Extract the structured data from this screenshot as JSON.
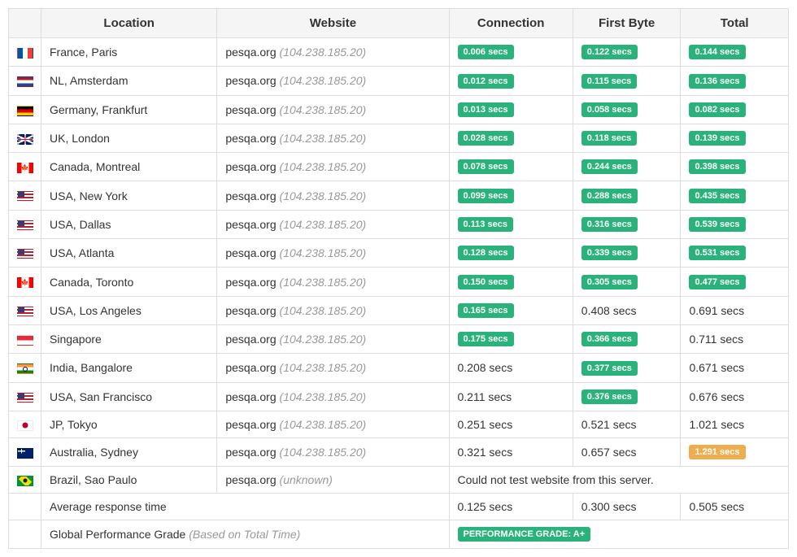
{
  "headers": {
    "location": "Location",
    "website": "Website",
    "connection": "Connection",
    "first_byte": "First Byte",
    "total": "Total"
  },
  "rows": [
    {
      "flag": "fr",
      "flag_name": "France",
      "location": "France, Paris",
      "site": "pesqa.org",
      "ip": "(104.238.185.20)",
      "conn": "0.006 secs",
      "conn_b": "green",
      "fb": "0.122 secs",
      "fb_b": "green",
      "tot": "0.144 secs",
      "tot_b": "green"
    },
    {
      "flag": "nl",
      "flag_name": "Netherlands",
      "location": "NL, Amsterdam",
      "site": "pesqa.org",
      "ip": "(104.238.185.20)",
      "conn": "0.012 secs",
      "conn_b": "green",
      "fb": "0.115 secs",
      "fb_b": "green",
      "tot": "0.136 secs",
      "tot_b": "green"
    },
    {
      "flag": "de",
      "flag_name": "Germany",
      "location": "Germany, Frankfurt",
      "site": "pesqa.org",
      "ip": "(104.238.185.20)",
      "conn": "0.013 secs",
      "conn_b": "green",
      "fb": "0.058 secs",
      "fb_b": "green",
      "tot": "0.082 secs",
      "tot_b": "green"
    },
    {
      "flag": "gb",
      "flag_name": "United Kingdom",
      "location": "UK, London",
      "site": "pesqa.org",
      "ip": "(104.238.185.20)",
      "conn": "0.028 secs",
      "conn_b": "green",
      "fb": "0.118 secs",
      "fb_b": "green",
      "tot": "0.139 secs",
      "tot_b": "green"
    },
    {
      "flag": "ca",
      "flag_name": "Canada",
      "location": "Canada, Montreal",
      "site": "pesqa.org",
      "ip": "(104.238.185.20)",
      "conn": "0.078 secs",
      "conn_b": "green",
      "fb": "0.244 secs",
      "fb_b": "green",
      "tot": "0.398 secs",
      "tot_b": "green"
    },
    {
      "flag": "us",
      "flag_name": "USA",
      "location": "USA, New York",
      "site": "pesqa.org",
      "ip": "(104.238.185.20)",
      "conn": "0.099 secs",
      "conn_b": "green",
      "fb": "0.288 secs",
      "fb_b": "green",
      "tot": "0.435 secs",
      "tot_b": "green"
    },
    {
      "flag": "us",
      "flag_name": "USA",
      "location": "USA, Dallas",
      "site": "pesqa.org",
      "ip": "(104.238.185.20)",
      "conn": "0.113 secs",
      "conn_b": "green",
      "fb": "0.316 secs",
      "fb_b": "green",
      "tot": "0.539 secs",
      "tot_b": "green"
    },
    {
      "flag": "us",
      "flag_name": "USA",
      "location": "USA, Atlanta",
      "site": "pesqa.org",
      "ip": "(104.238.185.20)",
      "conn": "0.128 secs",
      "conn_b": "green",
      "fb": "0.339 secs",
      "fb_b": "green",
      "tot": "0.531 secs",
      "tot_b": "green"
    },
    {
      "flag": "ca",
      "flag_name": "Canada",
      "location": "Canada, Toronto",
      "site": "pesqa.org",
      "ip": "(104.238.185.20)",
      "conn": "0.150 secs",
      "conn_b": "green",
      "fb": "0.305 secs",
      "fb_b": "green",
      "tot": "0.477 secs",
      "tot_b": "green"
    },
    {
      "flag": "us",
      "flag_name": "USA",
      "location": "USA, Los Angeles",
      "site": "pesqa.org",
      "ip": "(104.238.185.20)",
      "conn": "0.165 secs",
      "conn_b": "green",
      "fb": "0.408 secs",
      "fb_b": "",
      "tot": "0.691 secs",
      "tot_b": ""
    },
    {
      "flag": "sg",
      "flag_name": "Singapore",
      "location": "Singapore",
      "site": "pesqa.org",
      "ip": "(104.238.185.20)",
      "conn": "0.175 secs",
      "conn_b": "green",
      "fb": "0.366 secs",
      "fb_b": "green",
      "tot": "0.711 secs",
      "tot_b": ""
    },
    {
      "flag": "in",
      "flag_name": "India",
      "location": "India, Bangalore",
      "site": "pesqa.org",
      "ip": "(104.238.185.20)",
      "conn": "0.208 secs",
      "conn_b": "",
      "fb": "0.377 secs",
      "fb_b": "green",
      "tot": "0.671 secs",
      "tot_b": ""
    },
    {
      "flag": "us",
      "flag_name": "USA",
      "location": "USA, San Francisco",
      "site": "pesqa.org",
      "ip": "(104.238.185.20)",
      "conn": "0.211 secs",
      "conn_b": "",
      "fb": "0.376 secs",
      "fb_b": "green",
      "tot": "0.676 secs",
      "tot_b": ""
    },
    {
      "flag": "jp",
      "flag_name": "Japan",
      "location": "JP, Tokyo",
      "site": "pesqa.org",
      "ip": "(104.238.185.20)",
      "conn": "0.251 secs",
      "conn_b": "",
      "fb": "0.521 secs",
      "fb_b": "",
      "tot": "1.021 secs",
      "tot_b": ""
    },
    {
      "flag": "au",
      "flag_name": "Australia",
      "location": "Australia, Sydney",
      "site": "pesqa.org",
      "ip": "(104.238.185.20)",
      "conn": "0.321 secs",
      "conn_b": "",
      "fb": "0.657 secs",
      "fb_b": "",
      "tot": "1.291 secs",
      "tot_b": "orange"
    },
    {
      "flag": "br",
      "flag_name": "Brazil",
      "location": "Brazil, Sao Paulo",
      "site": "pesqa.org",
      "ip": "(unknown)",
      "error": "Could not test website from this server."
    }
  ],
  "average": {
    "label": "Average response time",
    "conn": "0.125 secs",
    "fb": "0.300 secs",
    "tot": "0.505 secs"
  },
  "grade": {
    "label": "Global Performance Grade",
    "sublabel": "(Based on Total Time)",
    "badge": "PERFORMANCE GRADE:  A+"
  }
}
